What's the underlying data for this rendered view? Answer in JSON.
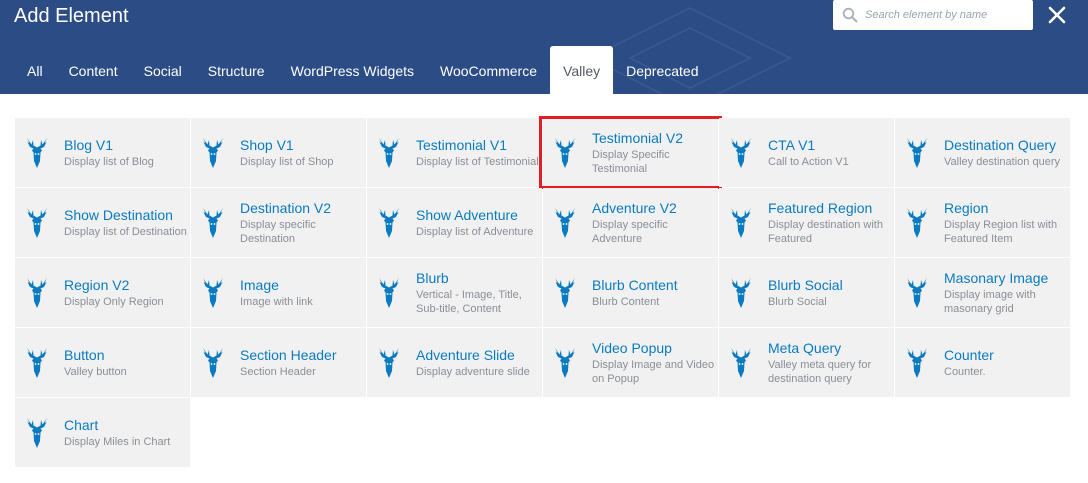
{
  "dialog": {
    "title": "Add Element",
    "search_placeholder": "Search element by name",
    "close_label": "✕"
  },
  "tabs": [
    {
      "label": "All",
      "active": false
    },
    {
      "label": "Content",
      "active": false
    },
    {
      "label": "Social",
      "active": false
    },
    {
      "label": "Structure",
      "active": false
    },
    {
      "label": "WordPress Widgets",
      "active": false
    },
    {
      "label": "WooCommerce",
      "active": false
    },
    {
      "label": "Valley",
      "active": true
    },
    {
      "label": "Deprecated",
      "active": false
    }
  ],
  "elements": [
    {
      "name": "Blog V1",
      "desc": "Display list of Blog"
    },
    {
      "name": "Shop V1",
      "desc": "Display list of Shop"
    },
    {
      "name": "Testimonial V1",
      "desc": "Display list of Testimonial"
    },
    {
      "name": "Testimonial V2",
      "desc": "Display Specific Testimonial",
      "highlighted": true
    },
    {
      "name": "CTA V1",
      "desc": "Call to Action V1"
    },
    {
      "name": "Destination Query",
      "desc": "Valley destination query"
    },
    {
      "name": "Show Destination",
      "desc": "Display list of Destination"
    },
    {
      "name": "Destination V2",
      "desc": "Display specific Destination"
    },
    {
      "name": "Show Adventure",
      "desc": "Display list of Adventure"
    },
    {
      "name": "Adventure V2",
      "desc": "Display specific Adventure"
    },
    {
      "name": "Featured Region",
      "desc": "Display destination with Featured"
    },
    {
      "name": "Region",
      "desc": "Display Region list with Featured Item"
    },
    {
      "name": "Region V2",
      "desc": "Display Only Region"
    },
    {
      "name": "Image",
      "desc": "Image with link"
    },
    {
      "name": "Blurb",
      "desc": "Vertical - Image, Title, Sub-title, Content"
    },
    {
      "name": "Blurb Content",
      "desc": "Blurb Content"
    },
    {
      "name": "Blurb Social",
      "desc": "Blurb Social"
    },
    {
      "name": "Masonary Image",
      "desc": "Display image with masonary grid"
    },
    {
      "name": "Button",
      "desc": "Valley button"
    },
    {
      "name": "Section Header",
      "desc": "Section Header"
    },
    {
      "name": "Adventure Slide",
      "desc": "Display adventure slide"
    },
    {
      "name": "Video Popup",
      "desc": "Display Image and Video on Popup"
    },
    {
      "name": "Meta Query",
      "desc": "Valley meta query for destination query"
    },
    {
      "name": "Counter",
      "desc": "Counter."
    },
    {
      "name": "Chart",
      "desc": "Display Miles in Chart"
    }
  ],
  "colors": {
    "header_bg": "#2b4c84",
    "link_blue": "#0a7bc0",
    "icon_blue": "#0a7bc0",
    "highlight_red": "#e31d24"
  },
  "icons": {
    "element_icon": "deer-head-icon",
    "search": "search-icon",
    "close": "close-icon"
  }
}
